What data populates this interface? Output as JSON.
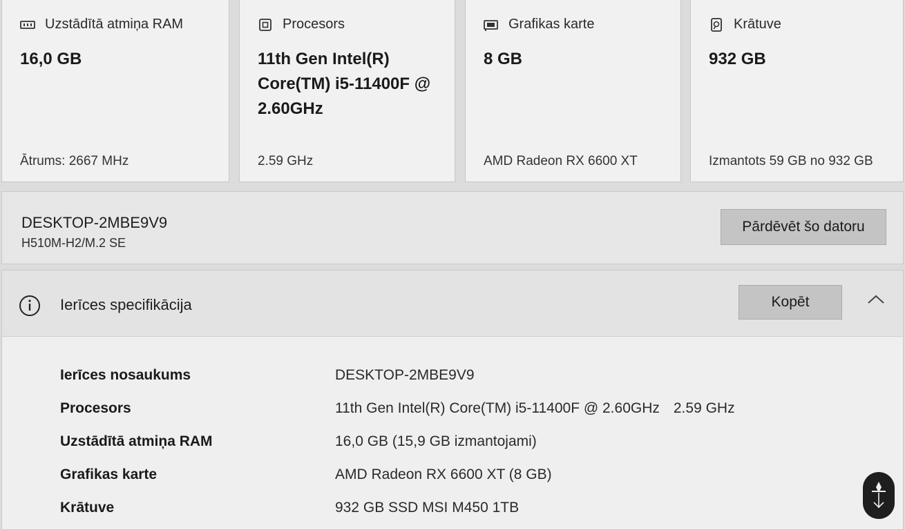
{
  "cards": [
    {
      "icon": "memory-icon",
      "title": "Uzstādītā atmiņa RAM",
      "value": "16,0 GB",
      "sub": "Ātrums: 2667 MHz"
    },
    {
      "icon": "processor-icon",
      "title": "Procesors",
      "value": "11th Gen Intel(R) Core(TM) i5-11400F @ 2.60GHz",
      "sub": "2.59 GHz"
    },
    {
      "icon": "graphics-card-icon",
      "title": "Grafikas karte",
      "value": "8 GB",
      "sub": "AMD Radeon RX 6600 XT"
    },
    {
      "icon": "storage-icon",
      "title": "Krātuve",
      "value": "932 GB",
      "sub": "Izmantots 59 GB no 932 GB"
    }
  ],
  "device": {
    "name": "DESKTOP-2MBE9V9",
    "model": "H510M-H2/M.2 SE",
    "rename_label": "Pārdēvēt šo datoru"
  },
  "spec": {
    "title": "Ierīces specifikācija",
    "copy_label": "Kopēt",
    "rows": [
      {
        "label": "Ierīces nosaukums",
        "value": "DESKTOP-2MBE9V9",
        "extra": ""
      },
      {
        "label": "Procesors",
        "value": "11th Gen Intel(R) Core(TM) i5-11400F @ 2.60GHz",
        "extra": "2.59 GHz"
      },
      {
        "label": "Uzstādītā atmiņa RAM",
        "value": "16,0 GB (15,9 GB izmantojami)",
        "extra": ""
      },
      {
        "label": "Grafikas karte",
        "value": "AMD Radeon RX 6600 XT (8 GB)",
        "extra": ""
      },
      {
        "label": "Krātuve",
        "value": "932 GB SSD MSI M450 1TB",
        "extra": ""
      }
    ]
  }
}
